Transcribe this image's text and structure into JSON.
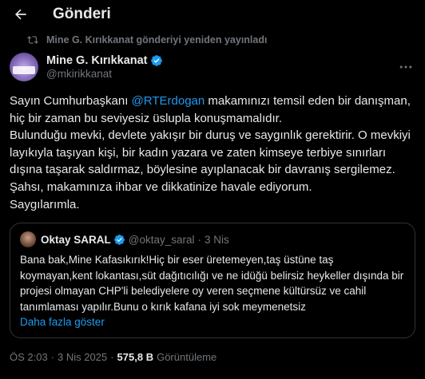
{
  "header": {
    "title": "Gönderi",
    "back_icon": "arrow-left-icon"
  },
  "repost": {
    "text": "Mine G. Kırıkkanat gönderiyi yeniden yayınladı",
    "icon": "repost-icon"
  },
  "author": {
    "display_name": "Mine G. Kırıkkanat",
    "handle": "@mkirikkanat",
    "verified_color": "#1d9bf0",
    "more_icon": "more-options-icon"
  },
  "tweet": {
    "text_before_mention": "Sayın Cumhurbaşkanı ",
    "mention": "@RTErdogan",
    "text_after_mention": " makamınızı temsil eden bir danışman, hiç bir zaman bu seviyesiz üslupla konuşmamalıdır.\nBulunduğu mevki, devlete yakışır bir duruş ve saygınlık gerektirir. O mevkiyi layıkıyla taşıyan kişi, bir kadın yazara ve zaten kimseye terbiye sınırları dışına taşarak saldırmaz, böylesine ayıplanacak bir davranış sergilemez.\nŞahsı, makamınıza ihbar ve dikkatinize havale ediyorum.\nSaygılarımla."
  },
  "quote": {
    "name": "Oktay SARAL",
    "handle": "@oktay_saral",
    "separator": "·",
    "date": "3 Nis",
    "text": "Bana bak,Mine Kafasıkırık!Hiç bir eser üretemeyen,taş üstüne taş koymayan,kent lokantası,süt dağıtıcılığı ve ne idüğü belirsiz heykeller dışında bir projesi olmayan CHP'li belediyelere oy veren seçmene kültürsüz ve cahil tanımlaması yapılır.Bunu o kırık kafana iyi sok meymenetsiz",
    "show_more": "Daha fazla göster"
  },
  "meta": {
    "time": "ÖS 2:03",
    "dot": "·",
    "date": "3 Nis 2025",
    "views_count": "575,8 B",
    "views_label": "Görüntüleme"
  },
  "colors": {
    "background": "#000000",
    "accent": "#1d9bf0",
    "muted": "#71767b",
    "text": "#e7e9ea"
  }
}
